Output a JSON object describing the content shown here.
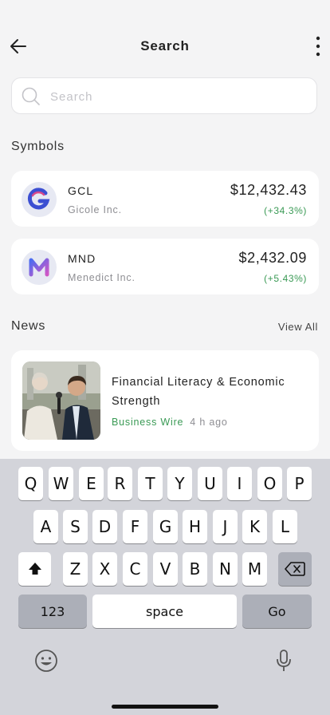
{
  "header": {
    "title": "Search"
  },
  "search": {
    "placeholder": "Search",
    "value": ""
  },
  "symbols": {
    "section_title": "Symbols",
    "items": [
      {
        "symbol": "GCL",
        "company": "Gicole Inc.",
        "price": "$12,432.43",
        "change": "(+34.3%)",
        "logo_icon": "gicole-logo-icon",
        "logo_color": "#3c4fd2"
      },
      {
        "symbol": "MND",
        "company": "Menedict Inc.",
        "price": "$2,432.09",
        "change": "(+5.43%)",
        "logo_icon": "menedict-logo-icon",
        "logo_color": "#b05ad6"
      }
    ]
  },
  "news": {
    "section_title": "News",
    "view_all_label": "View All",
    "items": [
      {
        "title": "Financial Literacy & Economic Strength",
        "source": "Business Wire",
        "time": "4 h ago",
        "image_icon": "news-interview-thumbnail"
      }
    ]
  },
  "keyboard": {
    "row1": [
      "Q",
      "W",
      "E",
      "R",
      "T",
      "Y",
      "U",
      "I",
      "O",
      "P"
    ],
    "row2": [
      "A",
      "S",
      "D",
      "F",
      "G",
      "H",
      "J",
      "K",
      "L"
    ],
    "row3": [
      "Z",
      "X",
      "C",
      "V",
      "B",
      "N",
      "M"
    ],
    "numbers_label": "123",
    "space_label": "space",
    "go_label": "Go",
    "shift_icon": "shift-icon",
    "backspace_icon": "backspace-icon",
    "emoji_icon": "emoji-icon",
    "mic_icon": "microphone-icon"
  },
  "colors": {
    "positive": "#3a9a55",
    "background": "#f4f4f5",
    "card": "#ffffff",
    "keyboard": "#d3d4da"
  }
}
